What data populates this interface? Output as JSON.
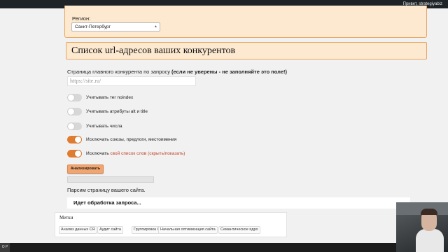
{
  "adminbar": {
    "greeting": "Привет, strategiyabiz"
  },
  "region": {
    "label": "Регион:",
    "selected": "Санкт-Петербург"
  },
  "section": {
    "title": "Список url-адресов ваших конкурентов"
  },
  "competitor": {
    "label_prefix": "Страница главного конкурента по запросу",
    "label_bold": "(если не уверены - не заполняйте это поле!)",
    "placeholder": "https://site.ru/"
  },
  "options": [
    {
      "label": "Учитывать тег noindex",
      "enabled": false
    },
    {
      "label": "Учитывать атрибуты alt и title",
      "enabled": false
    },
    {
      "label": "Учитывать числа",
      "enabled": false
    },
    {
      "label": "Исключать союзы, предлоги, местоимения",
      "enabled": true
    },
    {
      "label": "Исключать",
      "link": "свой список слов (скрыть/показать)",
      "enabled": true
    }
  ],
  "analyze_button": "Анализировать",
  "progress": {
    "value": 0
  },
  "parse_status": "Парсим страницу вашего сайта.",
  "request_status": "Идет обработка запроса...",
  "tags": {
    "title": "Метки",
    "items": [
      "Анализ данных СЯ",
      "Аудит сайта",
      "Группировка СЯ",
      "Начальная оптимизация сайта",
      "Семантическое ядро"
    ]
  },
  "bottom_bar": {
    "left_text": "O P"
  },
  "colors": {
    "accent": "#e07c2f",
    "panel_bg": "#fde9cf",
    "panel_border": "#e8a45c",
    "link": "#c0452d"
  }
}
